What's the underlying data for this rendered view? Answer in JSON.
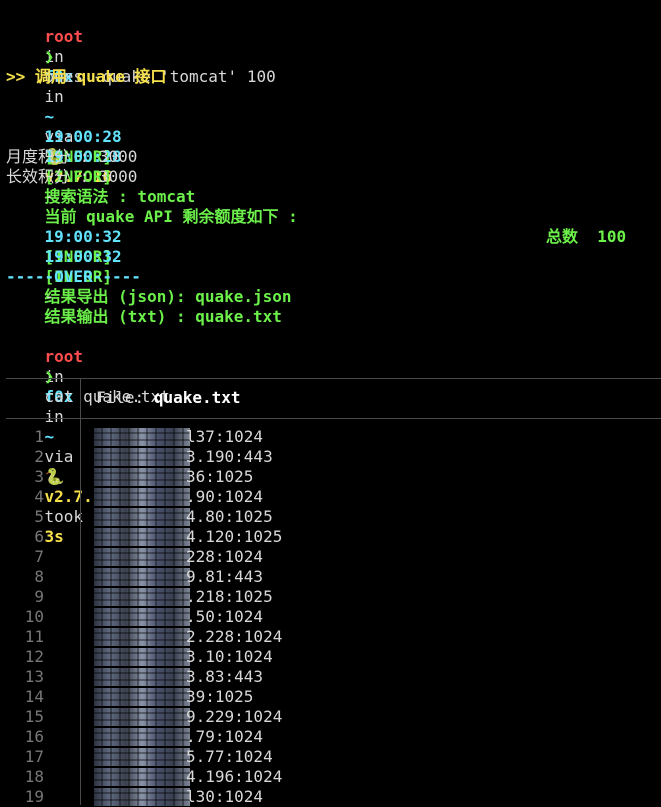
{
  "prompt1": {
    "user": "root",
    "in1": "in",
    "host": "f0x",
    "in2": "in",
    "dir": "~",
    "via": "via",
    "py_icon": "🐍",
    "version": "v2.7.16"
  },
  "cmd1": {
    "arrow": "❯",
    "text": "ones -quake 'tomcat' 100"
  },
  "header": ">> 调用 quake 接口",
  "logs": [
    {
      "time": "19:00:28",
      "level": "[INFOR]",
      "sep": "-",
      "msg": "搜索语法 : tomcat"
    },
    {
      "time": "19:00:28",
      "level": "[INFOR]",
      "sep": "-",
      "msg": "当前 quake API 剩余额度如下 :"
    }
  ],
  "quota": [
    "月度积分 : 3000",
    "长效积分 : 3000"
  ],
  "logs2": [
    {
      "time": "19:00:32",
      "level": "[INFOR]",
      "sep": "-",
      "msg": "结果导出 (json): quake.json"
    },
    {
      "time": "19:00:32",
      "level": "[INFOR]",
      "sep": "-",
      "msg": "结果输出 (txt) : quake.txt",
      "extra": "总数  100"
    }
  ],
  "over": "-----OVER-----",
  "prompt2": {
    "user": "root",
    "in1": "in",
    "host": "f0x",
    "in2": "in",
    "dir": "~",
    "via": "via",
    "py_icon": "🐍",
    "version": "v2.7.16",
    "took": "took",
    "duration": "3s"
  },
  "cmd2": {
    "arrow": "❯",
    "text": "cat quake.txt"
  },
  "file_header": {
    "label": "File:",
    "name": "quake.txt"
  },
  "rows": [
    {
      "n": "1",
      "ip": "l37:1024"
    },
    {
      "n": "2",
      "ip": "3.190:443"
    },
    {
      "n": "3",
      "ip": "36:1025"
    },
    {
      "n": "4",
      "ip": ".90:1024"
    },
    {
      "n": "5",
      "ip": "4.80:1025"
    },
    {
      "n": "6",
      "ip": "4.120:1025"
    },
    {
      "n": "7",
      "ip": "228:1024"
    },
    {
      "n": "8",
      "ip": "9.81:443"
    },
    {
      "n": "9",
      "ip": ".218:1025"
    },
    {
      "n": "10",
      "ip": ".50:1024"
    },
    {
      "n": "11",
      "ip": "2.228:1024"
    },
    {
      "n": "12",
      "ip": "3.10:1024"
    },
    {
      "n": "13",
      "ip": "3.83:443"
    },
    {
      "n": "14",
      "ip": "39:1025"
    },
    {
      "n": "15",
      "ip": "9.229:1024"
    },
    {
      "n": "16",
      "ip": ".79:1024"
    },
    {
      "n": "17",
      "ip": "5.77:1024"
    },
    {
      "n": "18",
      "ip": "4.196:1024"
    },
    {
      "n": "19",
      "ip": "l30:1024"
    }
  ]
}
